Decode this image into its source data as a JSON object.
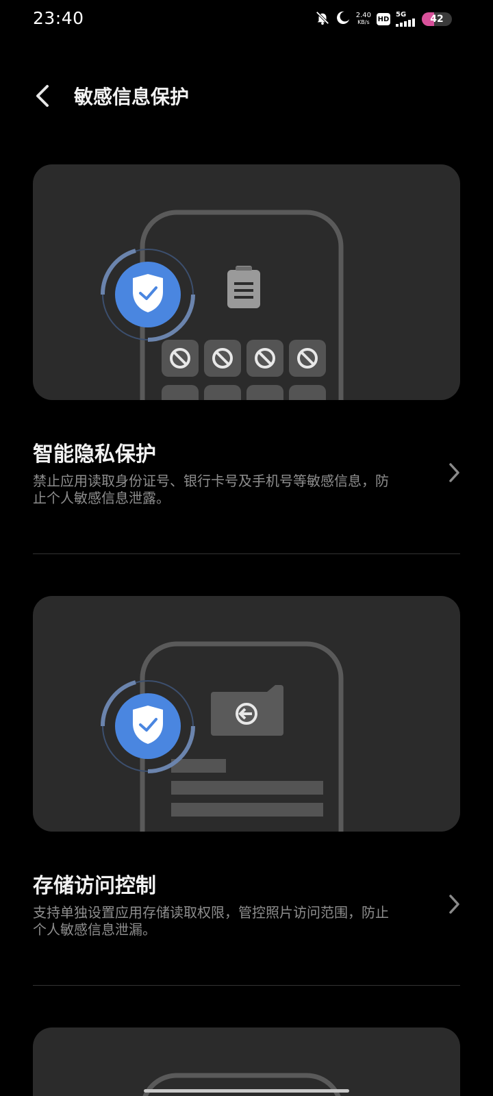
{
  "status_bar": {
    "time": "23:40",
    "net_speed_value": "2.40",
    "net_speed_unit": "KB/s",
    "hd_label": "HD",
    "network_label": "5G",
    "battery_level": "42",
    "battery_color": "#d8519a",
    "icons": [
      "bell-off-icon",
      "moon-icon",
      "signal-icon"
    ]
  },
  "header": {
    "title": "敏感信息保护",
    "back_icon": "chevron-left-icon"
  },
  "features": [
    {
      "title": "智能隐私保护",
      "description_line1": "禁止应用读取身份证号、银行卡号及手机号等敏感信息，防",
      "description_line2": "止个人敏感信息泄露。",
      "illustration": "shield-phone-clipboard-blocked-apps",
      "chevron": "chevron-right-icon"
    },
    {
      "title": "存储访问控制",
      "description_line1": "支持单独设置应用存储读取权限，管控照片访问范围，防止",
      "description_line2": "个人敏感信息泄漏。",
      "illustration": "shield-phone-folder-files",
      "chevron": "chevron-right-icon"
    }
  ],
  "colors": {
    "background": "#000000",
    "card": "#2b2b2b",
    "accent_blue": "#4a86e0",
    "text_secondary": "#8e8e8e"
  }
}
